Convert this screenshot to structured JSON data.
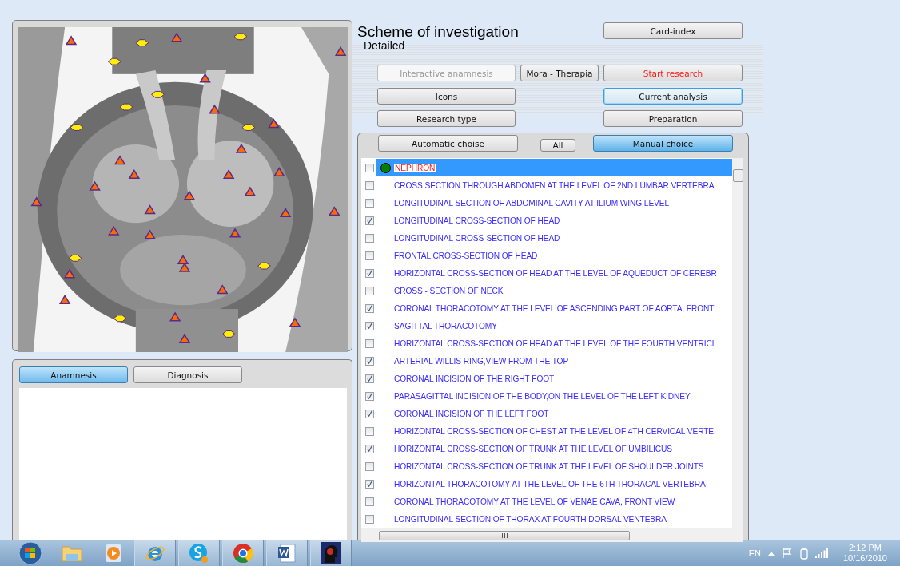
{
  "title": "Scheme of investigation",
  "subtitle": "Detailed",
  "button_rows": [
    {
      "right": {
        "label": "Card-index",
        "alert": false,
        "disabled": false,
        "focused": false
      }
    },
    {
      "left": {
        "label": "Interactive anamnesis",
        "alert": false,
        "disabled": true,
        "focused": false
      },
      "middle": {
        "label": "Mora - Therapia",
        "alert": false,
        "disabled": false,
        "focused": false
      },
      "right": {
        "label": "Start research",
        "alert": true,
        "disabled": false,
        "focused": false
      }
    },
    {
      "left": {
        "label": "Icons",
        "alert": false,
        "disabled": false,
        "focused": false
      },
      "right": {
        "label": "Current analysis",
        "alert": false,
        "disabled": false,
        "focused": true
      }
    },
    {
      "left": {
        "label": "Research type",
        "alert": false,
        "disabled": false,
        "focused": false
      },
      "right": {
        "label": "Preparation",
        "alert": false,
        "disabled": false,
        "focused": false
      }
    }
  ],
  "choice_buttons": [
    {
      "label": "Automatic choise",
      "selected": false
    },
    {
      "label": "All",
      "selected": false
    },
    {
      "label": "Manual choice",
      "selected": true
    }
  ],
  "sections": [
    {
      "text": "NEPHRON",
      "checked": false,
      "selected": true,
      "active": true
    },
    {
      "text": "CROSS SECTION THROUGH ABDOMEN AT THE LEVEL OF 2ND LUMBAR VERTEBRA",
      "checked": false,
      "selected": false,
      "active": false
    },
    {
      "text": "LONGITUDINAL SECTION OF ABDOMINAL CAVITY AT ILIUM WING LEVEL",
      "checked": false,
      "selected": false,
      "active": false
    },
    {
      "text": "LONGITUDINAL CROSS-SECTION OF HEAD",
      "checked": true,
      "selected": false,
      "active": false
    },
    {
      "text": "LONGITUDINAL CROSS-SECTION OF HEAD",
      "checked": false,
      "selected": false,
      "active": false
    },
    {
      "text": "FRONTAL CROSS-SECTION OF HEAD",
      "checked": false,
      "selected": false,
      "active": false
    },
    {
      "text": "HORIZONTAL CROSS-SECTION OF HEAD AT THE LEVEL OF AQUEDUCT OF CEREBR",
      "checked": true,
      "selected": false,
      "active": false
    },
    {
      "text": "CROSS - SECTION  OF   NECK",
      "checked": false,
      "selected": false,
      "active": false
    },
    {
      "text": "CORONAL THORACOTOMY AT THE LEVEL OF ASCENDING PART OF AORTA, FRONT",
      "checked": true,
      "selected": false,
      "active": false
    },
    {
      "text": "SAGITTAL THORACOTOMY",
      "checked": true,
      "selected": false,
      "active": false
    },
    {
      "text": "HORIZONTAL CROSS-SECTION OF HEAD AT THE LEVEL OF THE FOURTH VENTRICL",
      "checked": false,
      "selected": false,
      "active": false
    },
    {
      "text": "ARTERIAL WILLIS RING,VIEW FROM THE TOP",
      "checked": true,
      "selected": false,
      "active": false
    },
    {
      "text": "CORONAL INCISION OF THE RIGHT FOOT",
      "checked": true,
      "selected": false,
      "active": false
    },
    {
      "text": "PARASAGITTAL INCISION OF THE BODY,ON THE LEVEL OF THE LEFT KIDNEY",
      "checked": true,
      "selected": false,
      "active": false
    },
    {
      "text": "CORONAL INCISION OF THE LEFT FOOT",
      "checked": true,
      "selected": false,
      "active": false
    },
    {
      "text": "HORIZONTAL CROSS-SECTION OF CHEST AT THE LEVEL OF 4TH CERVICAL VERTE",
      "checked": false,
      "selected": false,
      "active": false
    },
    {
      "text": "HORIZONTAL CROSS-SECTION OF TRUNK AT THE LEVEL OF UMBILICUS",
      "checked": true,
      "selected": false,
      "active": false
    },
    {
      "text": "HORIZONTAL CROSS-SECTION OF TRUNK AT THE LEVEL OF SHOULDER JOINTS",
      "checked": false,
      "selected": false,
      "active": false
    },
    {
      "text": "HORIZONTAL THORACOTOMY AT THE LEVEL OF THE 6TH THORACAL VERTEBRA",
      "checked": true,
      "selected": false,
      "active": false
    },
    {
      "text": "CORONAL THORACOTOMY AT THE LEVEL OF VENAE CAVA, FRONT VIEW",
      "checked": false,
      "selected": false,
      "active": false
    },
    {
      "text": "LONGITUDINAL SECTION OF THORAX AT FOURTH DORSAL VENTEBRA",
      "checked": false,
      "selected": false,
      "active": false
    }
  ],
  "tabs": [
    {
      "label": "Anamnesis",
      "selected": true
    },
    {
      "label": "Diagnosis",
      "selected": false
    }
  ],
  "taskbar": {
    "language": "EN",
    "time": "2:12 PM",
    "date": "10/16/2010"
  }
}
